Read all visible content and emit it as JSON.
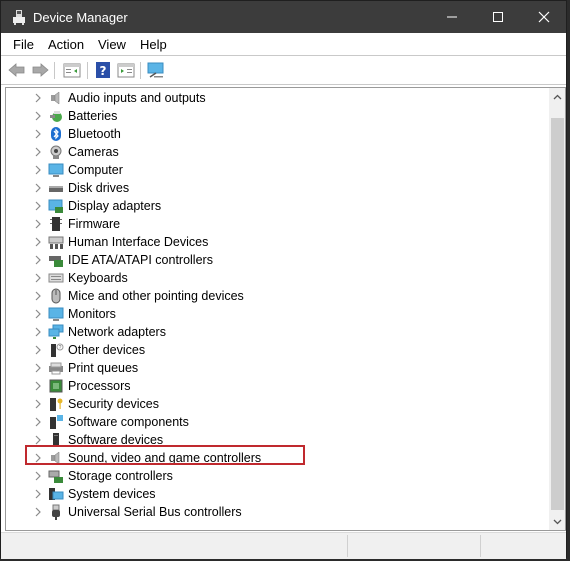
{
  "window": {
    "title": "Device Manager",
    "controls": {
      "minimize": "—",
      "maximize": "☐",
      "close": "✕"
    }
  },
  "menu": [
    "File",
    "Action",
    "View",
    "Help"
  ],
  "toolbar": {
    "buttons": [
      "back-arrow-icon",
      "forward-arrow-icon",
      "show-hide-console-tree-icon",
      "help-icon",
      "properties-icon",
      "scan-hardware-icon"
    ]
  },
  "tree": {
    "items": [
      {
        "label": "Audio inputs and outputs",
        "icon": "speaker-icon"
      },
      {
        "label": "Batteries",
        "icon": "battery-icon"
      },
      {
        "label": "Bluetooth",
        "icon": "bluetooth-icon"
      },
      {
        "label": "Cameras",
        "icon": "camera-icon"
      },
      {
        "label": "Computer",
        "icon": "computer-icon"
      },
      {
        "label": "Disk drives",
        "icon": "disk-drive-icon"
      },
      {
        "label": "Display adapters",
        "icon": "display-adapter-icon"
      },
      {
        "label": "Firmware",
        "icon": "firmware-chip-icon"
      },
      {
        "label": "Human Interface Devices",
        "icon": "hid-icon"
      },
      {
        "label": "IDE ATA/ATAPI controllers",
        "icon": "ide-controller-icon"
      },
      {
        "label": "Keyboards",
        "icon": "keyboard-icon"
      },
      {
        "label": "Mice and other pointing devices",
        "icon": "mouse-icon"
      },
      {
        "label": "Monitors",
        "icon": "monitor-icon"
      },
      {
        "label": "Network adapters",
        "icon": "network-icon"
      },
      {
        "label": "Other devices",
        "icon": "unknown-device-icon"
      },
      {
        "label": "Print queues",
        "icon": "printer-icon"
      },
      {
        "label": "Processors",
        "icon": "processor-icon"
      },
      {
        "label": "Security devices",
        "icon": "security-key-icon"
      },
      {
        "label": "Software components",
        "icon": "software-component-icon"
      },
      {
        "label": "Software devices",
        "icon": "software-device-icon"
      },
      {
        "label": "Sound, video and game controllers",
        "icon": "speaker-icon",
        "highlighted": true
      },
      {
        "label": "Storage controllers",
        "icon": "storage-controller-icon"
      },
      {
        "label": "System devices",
        "icon": "system-device-icon"
      },
      {
        "label": "Universal Serial Bus controllers",
        "icon": "usb-icon"
      }
    ]
  },
  "colors": {
    "titlebar": "#3c3c3c",
    "highlight_border": "#c0292e"
  }
}
